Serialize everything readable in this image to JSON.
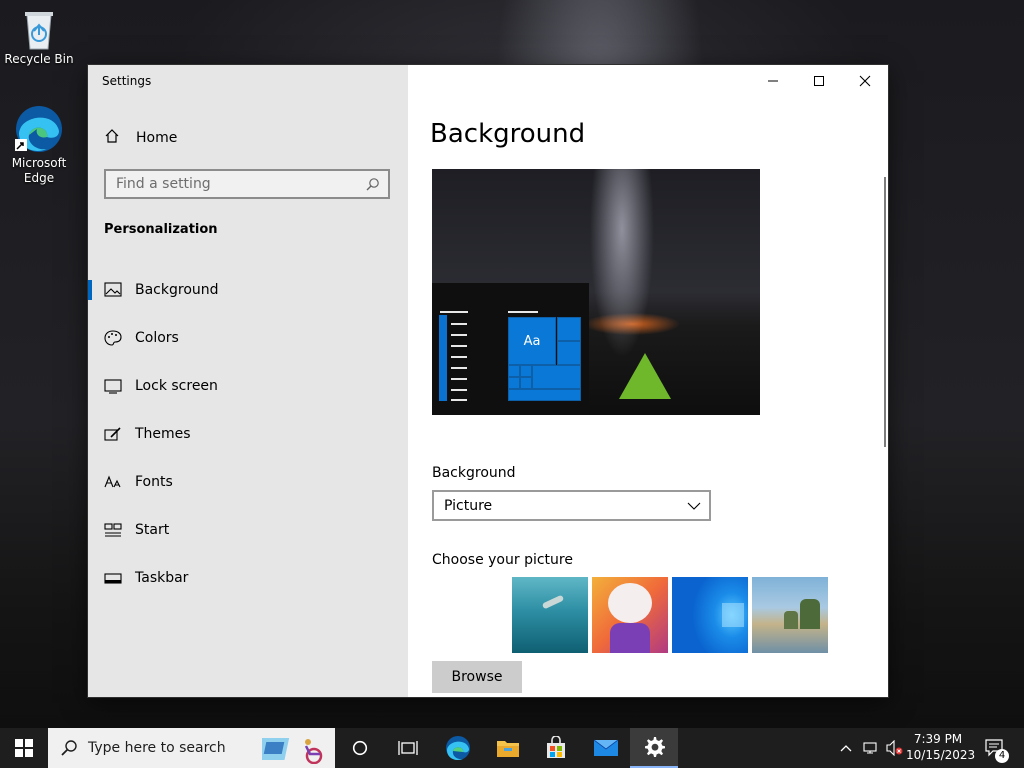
{
  "desktop": {
    "icons": [
      {
        "label": "Recycle Bin"
      },
      {
        "label": "Microsoft Edge"
      }
    ]
  },
  "window": {
    "title": "Settings",
    "controls": {
      "minimize": "minimize-icon",
      "maximize": "maximize-icon",
      "close": "close-icon"
    }
  },
  "sidebar": {
    "home_label": "Home",
    "search_placeholder": "Find a setting",
    "section": "Personalization",
    "items": [
      {
        "label": "Background",
        "icon": "picture-icon",
        "selected": true
      },
      {
        "label": "Colors",
        "icon": "palette-icon",
        "selected": false
      },
      {
        "label": "Lock screen",
        "icon": "lock-screen-icon",
        "selected": false
      },
      {
        "label": "Themes",
        "icon": "brush-icon",
        "selected": false
      },
      {
        "label": "Fonts",
        "icon": "font-icon",
        "selected": false
      },
      {
        "label": "Start",
        "icon": "start-icon",
        "selected": false
      },
      {
        "label": "Taskbar",
        "icon": "taskbar-icon",
        "selected": false
      }
    ]
  },
  "main": {
    "page_title": "Background",
    "preview_tile_text": "Aa",
    "background_label": "Background",
    "background_value": "Picture",
    "choose_label": "Choose your picture",
    "thumbnails": [
      "underwater-swimmer",
      "cartoon-character",
      "windows-blue-logo",
      "beach-rocks"
    ],
    "browse_label": "Browse"
  },
  "taskbar": {
    "search_placeholder": "Type here to search",
    "apps": [
      "cortana-icon",
      "task-view-icon",
      "edge-icon",
      "file-explorer-icon",
      "store-icon",
      "mail-icon",
      "settings-icon"
    ],
    "time": "7:39 PM",
    "date": "10/15/2023",
    "notifications": "4"
  },
  "colors": {
    "accent": "#0067c0",
    "tile": "#0a78d7",
    "sidebar_bg": "#e6e6e6",
    "taskbar_bg": "#1e1e1e"
  }
}
